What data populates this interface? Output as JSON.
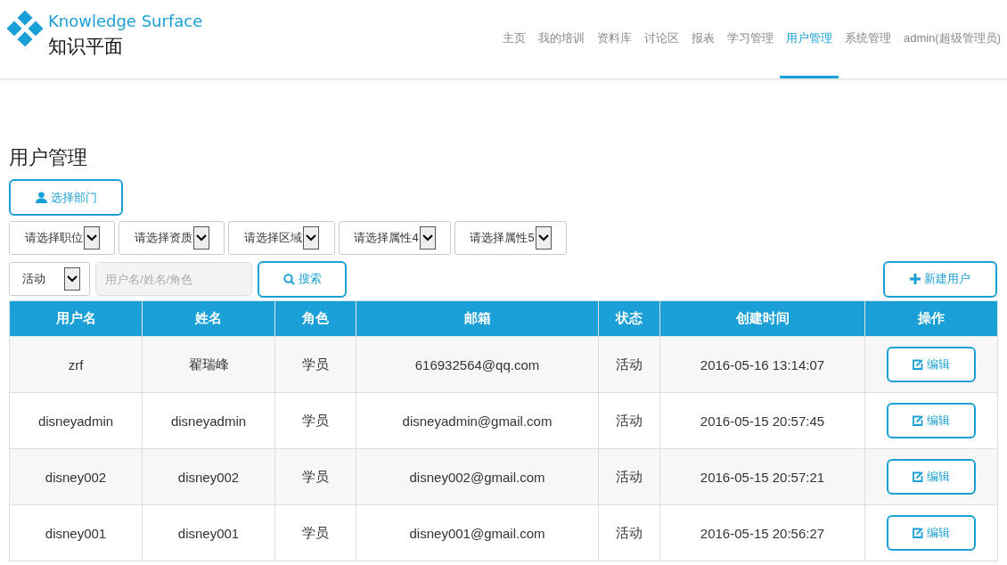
{
  "logo": {
    "title": "Knowledge Surface",
    "subtitle": "知识平面"
  },
  "nav": [
    {
      "label": "主页",
      "selected": false
    },
    {
      "label": "我的培训",
      "selected": false
    },
    {
      "label": "资料库",
      "selected": false
    },
    {
      "label": "讨论区",
      "selected": false
    },
    {
      "label": "报表",
      "selected": false
    },
    {
      "label": "学习管理",
      "selected": false
    },
    {
      "label": "用户管理",
      "selected": true
    },
    {
      "label": "系统管理",
      "selected": false
    },
    {
      "label": "admin(超级管理员)",
      "selected": false
    }
  ],
  "page_title": "用户管理",
  "department_button": "选择部门",
  "filters": [
    "请选择职位",
    "请选择资质",
    "请选择区域",
    "请选择属性4",
    "请选择属性5"
  ],
  "status_select": "活动",
  "search": {
    "placeholder": "用户名/姓名/角色",
    "button": "搜索"
  },
  "new_user_button": "新建用户",
  "table": {
    "columns": [
      "用户名",
      "姓名",
      "角色",
      "邮箱",
      "状态",
      "创建时间",
      "操作"
    ],
    "rows": [
      {
        "cells": [
          "zrf",
          "翟瑞峰",
          "学员",
          "616932564@qq.com",
          "活动",
          "2016-05-16 13:14:07"
        ],
        "action": "编辑"
      },
      {
        "cells": [
          "disneyadmin",
          "disneyadmin",
          "学员",
          "disneyadmin@gmail.com",
          "活动",
          "2016-05-15 20:57:45"
        ],
        "action": "编辑"
      },
      {
        "cells": [
          "disney002",
          "disney002",
          "学员",
          "disney002@gmail.com",
          "活动",
          "2016-05-15 20:57:21"
        ],
        "action": "编辑"
      },
      {
        "cells": [
          "disney001",
          "disney001",
          "学员",
          "disney001@gmail.com",
          "活动",
          "2016-05-15 20:56:27"
        ],
        "action": "编辑"
      }
    ]
  }
}
